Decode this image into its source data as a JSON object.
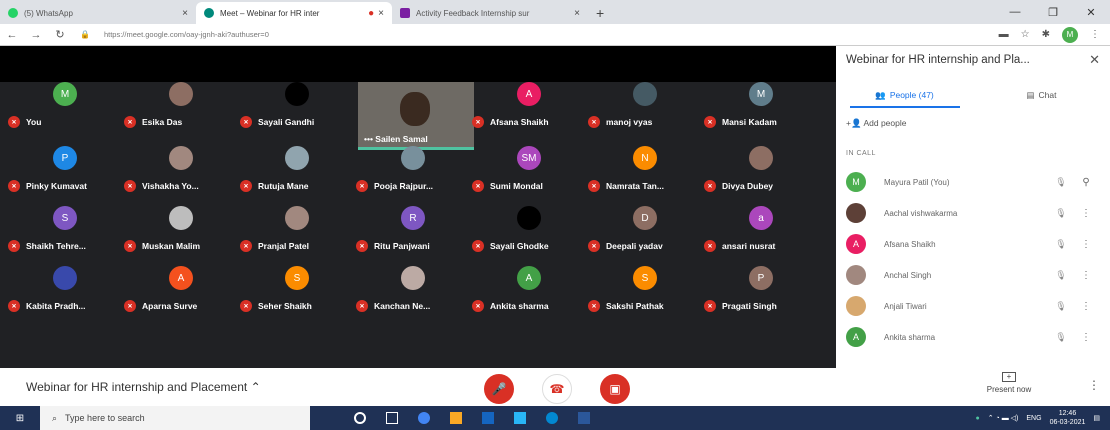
{
  "tabs": [
    {
      "title": "(5) WhatsApp",
      "color": "#25d366",
      "active": false
    },
    {
      "title": "Meet – Webinar for HR inter",
      "color": "#00897b",
      "active": true
    },
    {
      "title": "Activity Feedback Internship sur",
      "color": "#7b1fa2",
      "active": false
    }
  ],
  "address": {
    "url": "https://meet.google.com/oay-jgnh-aki?authuser=0",
    "profile": "M"
  },
  "grid": {
    "video_tile": {
      "name": "Sailen Samal"
    },
    "tiles": [
      {
        "name": "You",
        "initial": "M",
        "color": "#4caf50"
      },
      {
        "name": "Esika Das",
        "initial": "",
        "color": "#8d6e63"
      },
      {
        "name": "Sayali Gandhi",
        "initial": "",
        "color": "#000000"
      },
      {
        "name": "Afsana Shaikh",
        "initial": "A",
        "color": "#e91e63"
      },
      {
        "name": "manoj vyas",
        "initial": "",
        "color": "#455a64"
      },
      {
        "name": "Mansi Kadam",
        "initial": "M",
        "color": "#607d8b"
      },
      {
        "name": "Pinky Kumavat",
        "initial": "P",
        "color": "#1e88e5"
      },
      {
        "name": "Vishakha Yo...",
        "initial": "",
        "color": "#a1887f"
      },
      {
        "name": "Rutuja Mane",
        "initial": "",
        "color": "#90a4ae"
      },
      {
        "name": "Pooja Rajpur...",
        "initial": "",
        "color": "#78909c"
      },
      {
        "name": "Sumi Mondal",
        "initial": "SM",
        "color": "#ab47bc"
      },
      {
        "name": "Namrata Tan...",
        "initial": "N",
        "color": "#fb8c00"
      },
      {
        "name": "Divya Dubey",
        "initial": "",
        "color": "#8d6e63"
      },
      {
        "name": "Shaikh Tehre...",
        "initial": "S",
        "color": "#7e57c2"
      },
      {
        "name": "Muskan Malim",
        "initial": "",
        "color": "#bdbdbd"
      },
      {
        "name": "Pranjal Patel",
        "initial": "",
        "color": "#a1887f"
      },
      {
        "name": "Ritu Panjwani",
        "initial": "R",
        "color": "#7e57c2"
      },
      {
        "name": "Sayali Ghodke",
        "initial": "",
        "color": "#000000"
      },
      {
        "name": "Deepali yadav",
        "initial": "D",
        "color": "#8d6e63"
      },
      {
        "name": "ansari nusrat",
        "initial": "a",
        "color": "#ab47bc"
      },
      {
        "name": "Kabita Pradh...",
        "initial": "",
        "color": "#3949ab"
      },
      {
        "name": "Aparna Surve",
        "initial": "A",
        "color": "#f4511e"
      },
      {
        "name": "Seher Shaikh",
        "initial": "S",
        "color": "#fb8c00"
      },
      {
        "name": "Kanchan Ne...",
        "initial": "",
        "color": "#bcaaa4"
      },
      {
        "name": "Ankita sharma",
        "initial": "A",
        "color": "#43a047"
      },
      {
        "name": "Sakshi Pathak",
        "initial": "S",
        "color": "#fb8c00"
      },
      {
        "name": "Pragati Singh",
        "initial": "P",
        "color": "#8d6e63"
      }
    ]
  },
  "side": {
    "title": "Webinar for HR internship and Pla...",
    "people_tab": "People (47)",
    "chat_tab": "Chat",
    "add_people": "Add people",
    "in_call": "IN CALL",
    "people": [
      {
        "name": "Mayura Patil (You)",
        "initial": "M",
        "color": "#4caf50"
      },
      {
        "name": "Aachal vishwakarma",
        "initial": "",
        "color": "#5d4037"
      },
      {
        "name": "Afsana Shaikh",
        "initial": "A",
        "color": "#e91e63"
      },
      {
        "name": "Anchal Singh",
        "initial": "",
        "color": "#a1887f"
      },
      {
        "name": "Anjali Tiwari",
        "initial": "",
        "color": "#d7a86e"
      },
      {
        "name": "Ankita sharma",
        "initial": "A",
        "color": "#43a047"
      }
    ]
  },
  "bottom": {
    "meeting_title": "Webinar for HR internship and Placement",
    "present_label": "Present now"
  },
  "taskbar": {
    "search_placeholder": "Type here to search",
    "lang": "ENG",
    "time": "12:46",
    "date": "06-03-2021"
  }
}
